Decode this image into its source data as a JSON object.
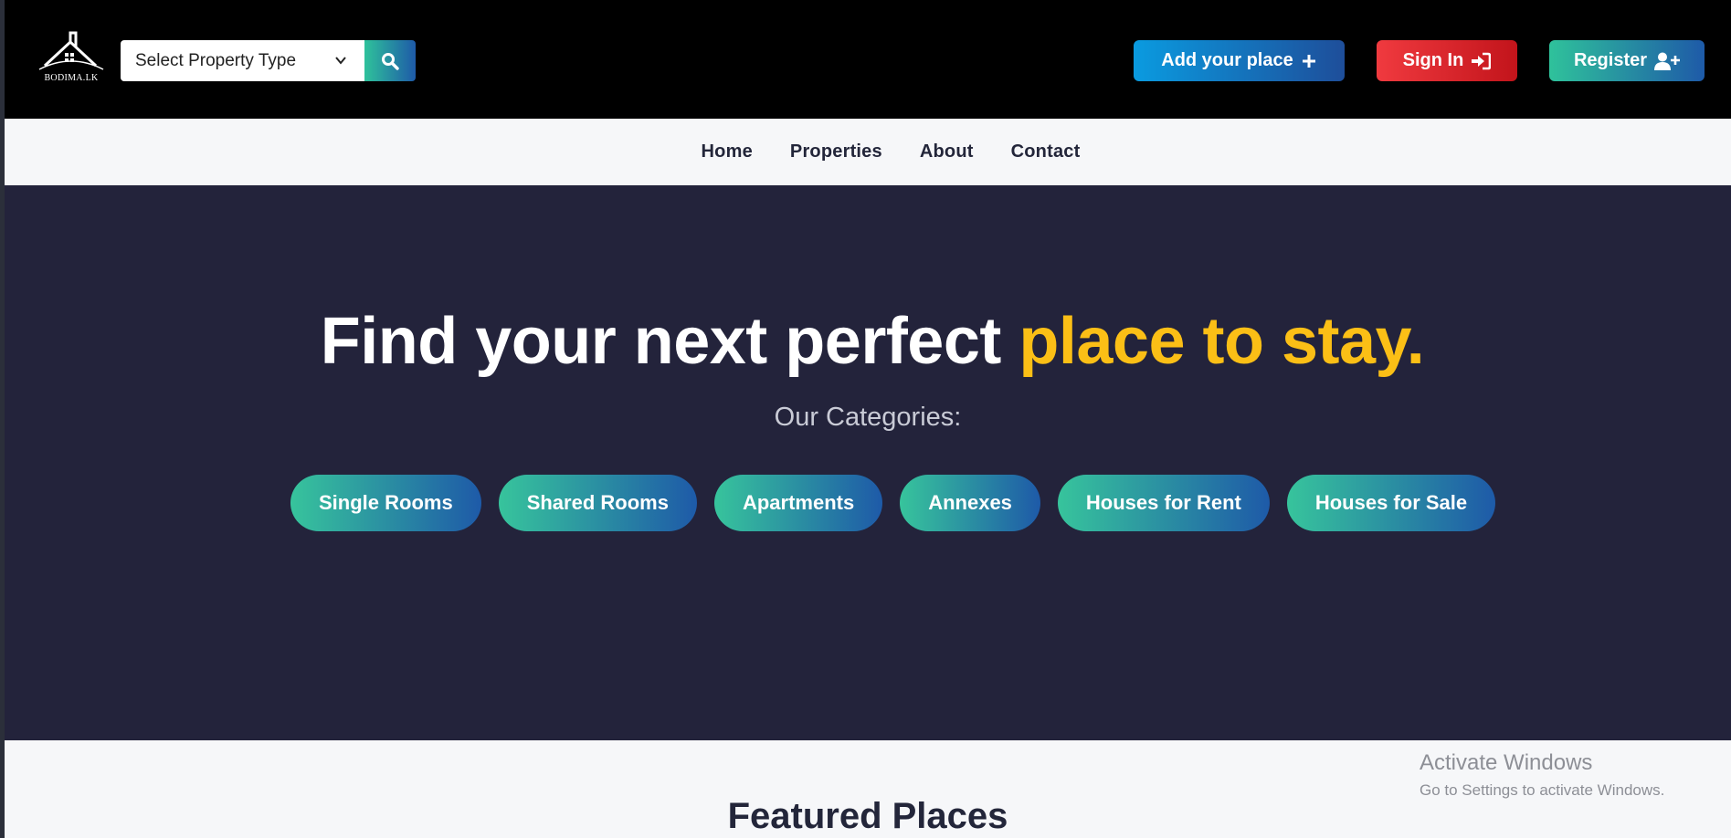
{
  "header": {
    "brand": "BODIMA.LK",
    "property_select": {
      "value": "Select Property Type"
    },
    "buttons": {
      "add_place": "Add your place",
      "sign_in": "Sign In",
      "register": "Register"
    }
  },
  "nav": {
    "items": [
      {
        "label": "Home"
      },
      {
        "label": "Properties"
      },
      {
        "label": "About"
      },
      {
        "label": "Contact"
      }
    ]
  },
  "hero": {
    "title_main": "Find your next perfect",
    "title_highlight": "place to stay.",
    "subtitle": "Our Categories:",
    "categories": [
      {
        "label": "Single Rooms"
      },
      {
        "label": "Shared Rooms"
      },
      {
        "label": "Apartments"
      },
      {
        "label": "Annexes"
      },
      {
        "label": "Houses for Rent"
      },
      {
        "label": "Houses for Sale"
      }
    ]
  },
  "featured": {
    "title": "Featured Places"
  },
  "watermark": {
    "line1": "Activate Windows",
    "line2": "Go to Settings to activate Windows."
  },
  "colors": {
    "header_bg": "#000000",
    "hero_bg": "#23233b",
    "highlight": "#fbbf16",
    "teal": "#2fc29b",
    "blue": "#1e5aa8",
    "red": "#f03a3f"
  },
  "icons": {
    "search": "search-icon",
    "add": "plus-icon",
    "sign_in": "sign-in-icon",
    "register": "user-plus-icon",
    "select": "chevron-down-icon"
  }
}
